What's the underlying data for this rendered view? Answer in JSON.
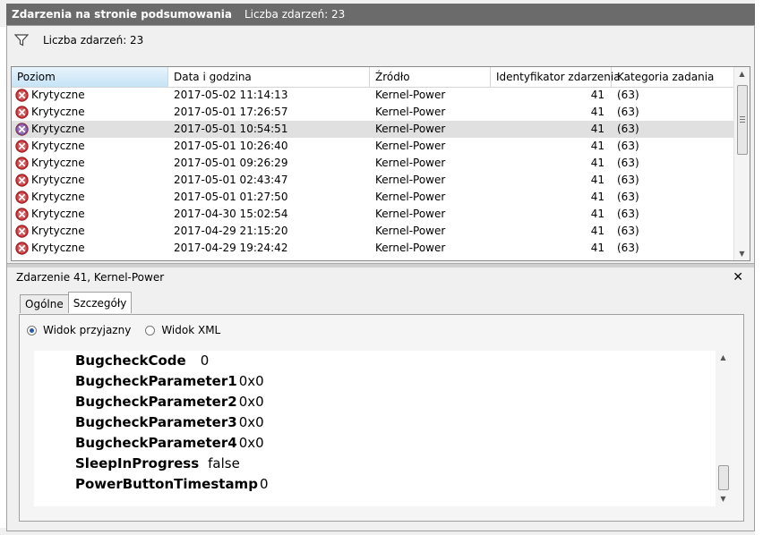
{
  "window": {
    "title": "Zdarzenia na stronie podsumowania",
    "title_count": "Liczba zdarzeń: 23"
  },
  "filter": {
    "icon": "filter-icon",
    "count_label": "Liczba zdarzeń: 23"
  },
  "table": {
    "columns": [
      "Poziom",
      "Data i godzina",
      "Źródło",
      "Identyfikator zdarzenia",
      "Kategoria zadania"
    ],
    "rows": [
      {
        "level": "Krytyczne",
        "datetime": "2017-05-02 11:14:13",
        "source": "Kernel-Power",
        "id": "41",
        "category": "(63)"
      },
      {
        "level": "Krytyczne",
        "datetime": "2017-05-01 17:26:57",
        "source": "Kernel-Power",
        "id": "41",
        "category": "(63)"
      },
      {
        "level": "Krytyczne",
        "datetime": "2017-05-01 10:54:51",
        "source": "Kernel-Power",
        "id": "41",
        "category": "(63)"
      },
      {
        "level": "Krytyczne",
        "datetime": "2017-05-01 10:26:40",
        "source": "Kernel-Power",
        "id": "41",
        "category": "(63)"
      },
      {
        "level": "Krytyczne",
        "datetime": "2017-05-01 09:26:29",
        "source": "Kernel-Power",
        "id": "41",
        "category": "(63)"
      },
      {
        "level": "Krytyczne",
        "datetime": "2017-05-01 02:43:47",
        "source": "Kernel-Power",
        "id": "41",
        "category": "(63)"
      },
      {
        "level": "Krytyczne",
        "datetime": "2017-05-01 01:27:50",
        "source": "Kernel-Power",
        "id": "41",
        "category": "(63)"
      },
      {
        "level": "Krytyczne",
        "datetime": "2017-04-30 15:02:54",
        "source": "Kernel-Power",
        "id": "41",
        "category": "(63)"
      },
      {
        "level": "Krytyczne",
        "datetime": "2017-04-29 21:15:20",
        "source": "Kernel-Power",
        "id": "41",
        "category": "(63)"
      },
      {
        "level": "Krytyczne",
        "datetime": "2017-04-29 19:24:42",
        "source": "Kernel-Power",
        "id": "41",
        "category": "(63)"
      }
    ],
    "selected_row": 2
  },
  "detail": {
    "title": "Zdarzenie 41, Kernel-Power",
    "close_icon": "close-icon",
    "tabs": [
      "Ogólne",
      "Szczegóły"
    ],
    "active_tab": "Szczegóły",
    "radio_friendly": "Widok przyjazny",
    "radio_xml": "Widok XML",
    "fields": [
      {
        "key": "BugcheckCode",
        "value": "0"
      },
      {
        "key": "BugcheckParameter1",
        "value": "0x0"
      },
      {
        "key": "BugcheckParameter2",
        "value": "0x0"
      },
      {
        "key": "BugcheckParameter3",
        "value": "0x0"
      },
      {
        "key": "BugcheckParameter4",
        "value": "0x0"
      },
      {
        "key": "SleepInProgress",
        "value": "false"
      },
      {
        "key": "PowerButtonTimestamp",
        "value": "0"
      }
    ]
  },
  "colors": {
    "titlebar": "#6b6b6b",
    "error_red": "#c0282d",
    "selected_row": "#e0e0e0",
    "header_selected": "#c6e3f6"
  }
}
